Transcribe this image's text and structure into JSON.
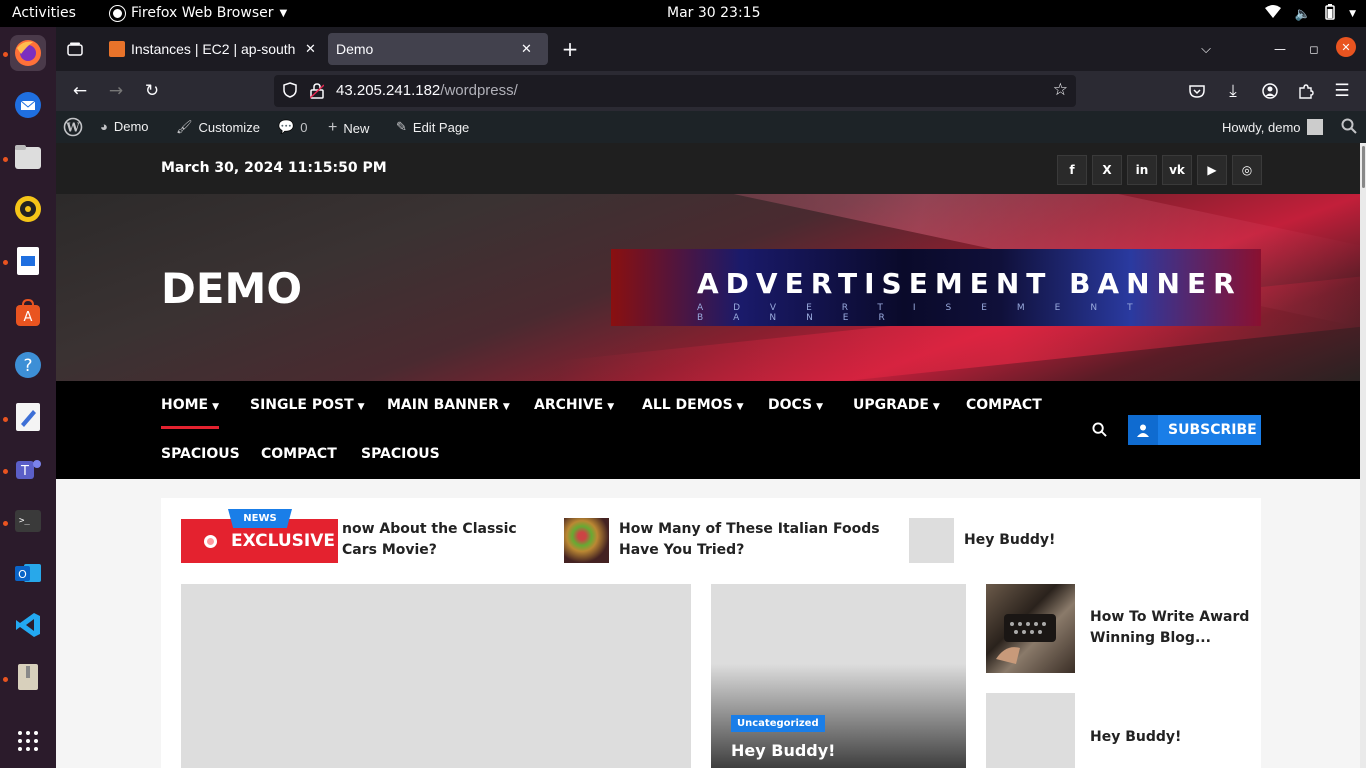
{
  "topbar": {
    "activities": "Activities",
    "app_name": "Firefox Web Browser",
    "clock": "Mar 30  23:15"
  },
  "dock": {
    "apps": [
      "firefox-icon",
      "thunderbird-icon",
      "files-icon",
      "rhythmbox-icon",
      "writer-icon",
      "app-center-icon",
      "help-icon",
      "text-editor-icon",
      "teams-icon",
      "terminal-icon",
      "outlook-icon",
      "vscode-icon",
      "archive-icon",
      "show-apps-icon"
    ]
  },
  "browser": {
    "tabs": [
      {
        "label": "Instances | EC2 | ap-south",
        "active": false
      },
      {
        "label": "Demo",
        "active": true
      }
    ],
    "url_host": "43.205.241.182",
    "url_path": "/wordpress/"
  },
  "wpbar": {
    "site": "Demo",
    "customize": "Customize",
    "comments": "0",
    "new": "New",
    "edit": "Edit Page",
    "howdy": "Howdy, demo"
  },
  "site": {
    "datetime": "March 30, 2024 11:15:50 PM",
    "social": [
      "f",
      "X",
      "in",
      "vk",
      "▶",
      "◎"
    ],
    "title": "DEMO",
    "ad_title": "ADVERTISEMENT BANNER",
    "ad_sub": "ADVERTISEMENT BANNER",
    "nav": {
      "row1": [
        "HOME",
        "SINGLE POST",
        "MAIN BANNER",
        "ARCHIVE",
        "ALL DEMOS",
        "DOCS",
        "UPGRADE",
        "COMPACT"
      ],
      "row2": [
        "SPACIOUS",
        "COMPACT",
        "SPACIOUS"
      ]
    },
    "subscribe": "SUBSCRIBE",
    "ticker": {
      "badge": "NEWS",
      "label": "EXCLUSIVE",
      "items": [
        "now About the Classic Cars Movie?",
        "How Many of These Italian Foods Have You Tried?",
        "Hey Buddy!"
      ]
    },
    "featured": {
      "category": "Uncategorized",
      "title": "Hey Buddy!"
    },
    "side_posts": [
      "How To Write Award Winning Blog...",
      "Hey Buddy!"
    ]
  },
  "colors": {
    "accent_red": "#e4222f",
    "accent_blue": "#1a7ee8"
  }
}
